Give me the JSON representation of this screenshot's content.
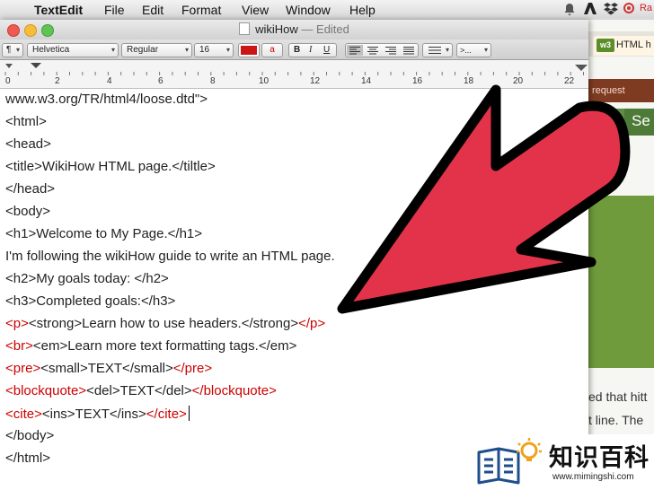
{
  "menubar": {
    "apple": "",
    "app_name": "TextEdit",
    "items": [
      "File",
      "Edit",
      "Format",
      "View",
      "Window",
      "Help"
    ],
    "right_label": "Ra"
  },
  "window": {
    "title": "wikiHow",
    "title_status": "— Edited"
  },
  "toolbar": {
    "paragraph_style": "¶",
    "font_family": "Helvetica",
    "font_style": "Regular",
    "font_size": "16",
    "bold": "B",
    "italic": "I",
    "underline": "U",
    "text_color_button": "a",
    "list_button": ">...",
    "text_color": "#cc1515"
  },
  "ruler": {
    "ticks": [
      "0",
      "2",
      "4",
      "6",
      "8",
      "10",
      "12",
      "14",
      "16",
      "18",
      "20",
      "22"
    ]
  },
  "document": {
    "lines": [
      [
        "    www.w3.org/TR/html4/loose.dtd\">"
      ],
      [
        "<html>"
      ],
      [
        "<head>"
      ],
      [
        "<title>WikiHow HTML page.</tiltle>"
      ],
      [
        "</head>"
      ],
      [
        "<body>"
      ],
      [
        "<h1>Welcome to My Page.</h1>"
      ],
      [
        "I'm following the wikiHow guide to write an HTML page."
      ],
      [
        "<h2>My goals today: </h2>"
      ],
      [
        "<h3>Completed goals:</h3>"
      ],
      [
        "<p>",
        "<strong>Learn how to use headers.</strong>",
        "</p>"
      ],
      [
        "<br>",
        "<em>Learn more text formatting tags.</em>"
      ],
      [
        "<pre>",
        "<small>TEXT</small>",
        "</pre>"
      ],
      [
        "<blockquote>",
        "<del>TEXT</del>",
        "</blockquote>"
      ],
      [
        "<cite>",
        "<ins>TEXT</ins>",
        "</cite>"
      ],
      [
        "</body>"
      ],
      [
        "</html>"
      ]
    ]
  },
  "background_window": {
    "tab_badge": "w3",
    "tab_title": "HTML h",
    "request_label": "request",
    "search_button": "Se",
    "text_line_1": "ed that hitt",
    "text_line_2": "t line. The"
  },
  "logo": {
    "name": "知识百科",
    "url": "www.mimingshi.com"
  },
  "colors": {
    "arrow_fill": "#e3334a",
    "arrow_stroke": "#000000",
    "code_red": "#cc0000"
  }
}
